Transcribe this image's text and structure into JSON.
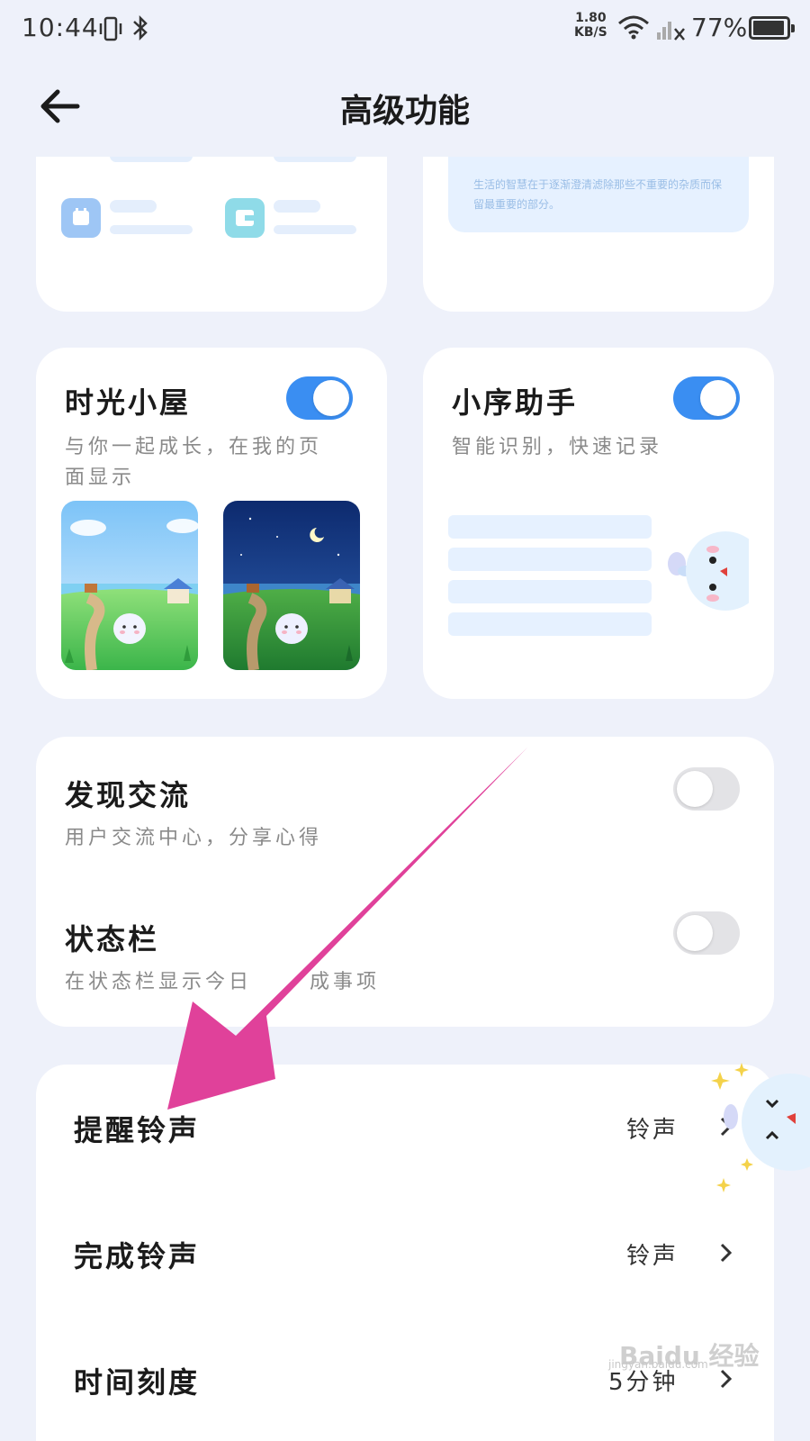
{
  "status_bar": {
    "time": "10:44",
    "net_speed_value": "1.80",
    "net_speed_unit": "KB/S",
    "battery": "77%"
  },
  "header": {
    "title": "高级功能"
  },
  "top_right_card": {
    "quote": "生活的智慧在于逐渐澄清滤除那些不重要的杂质而保留最重要的部分。"
  },
  "time_cabin": {
    "title": "时光小屋",
    "subtitle": "与你一起成长，在我的页面显示",
    "toggle_on": true
  },
  "assistant": {
    "title": "小序助手",
    "subtitle": "智能识别，快速记录",
    "toggle_on": true
  },
  "discover": {
    "title": "发现交流",
    "subtitle": "用户交流中心，分享心得",
    "toggle_on": false
  },
  "status_bar_setting": {
    "title": "状态栏",
    "subtitle": "在状态栏显示今日",
    "subtitle_tail": "成事项",
    "toggle_on": false
  },
  "settings": [
    {
      "title": "提醒铃声",
      "value": "铃声"
    },
    {
      "title": "完成铃声",
      "value": "铃声"
    },
    {
      "title": "时间刻度",
      "value": "5分钟"
    }
  ],
  "watermark": {
    "logo": "Baidu 经验",
    "url": "jingyan.baidu.com"
  },
  "colors": {
    "accent": "#3a8ef2",
    "background": "#eef1fa",
    "arrow": "#e0419a"
  }
}
